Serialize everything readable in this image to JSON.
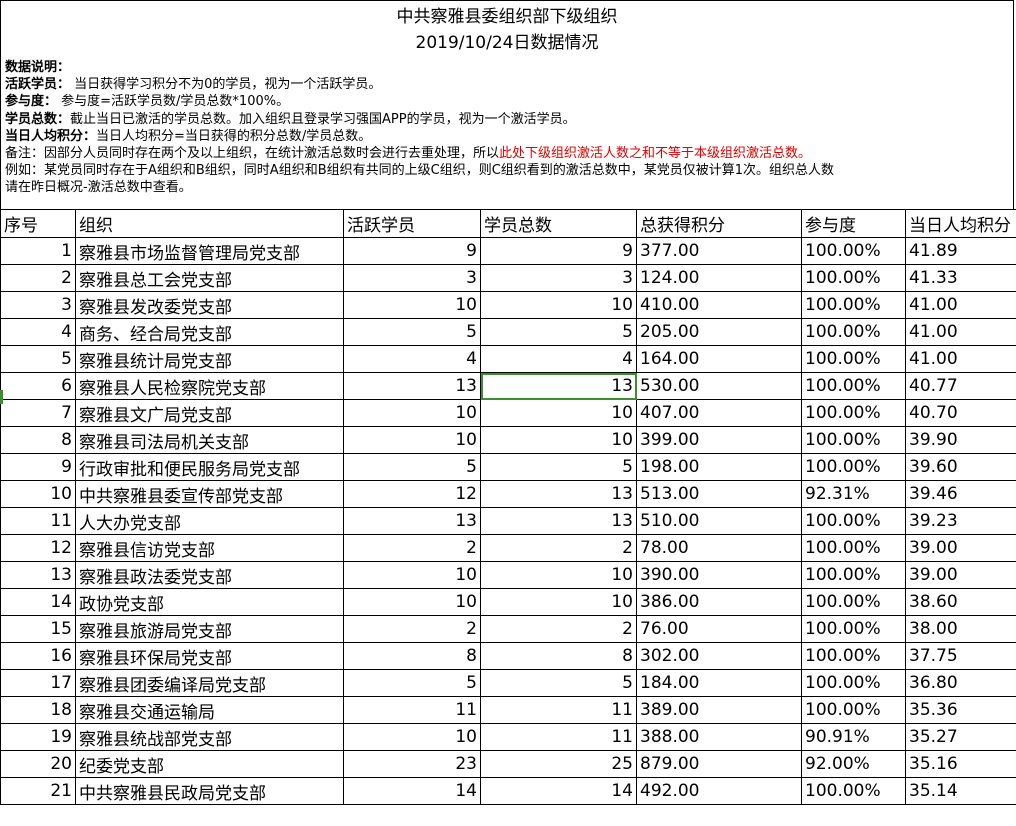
{
  "title": {
    "line1": "中共察雅县委组织部下级组织",
    "line2": "2019/10/24日数据情况"
  },
  "notes": {
    "header": "数据说明：",
    "active_label": "活跃学员：",
    "active_text": "  当日获得学习积分不为0的学员，视为一个活跃学员。",
    "participation_label": "参与度：",
    "participation_text": "  参与度=活跃学员数/学员总数*100%。",
    "total_label": "学员总数：",
    "total_text": "截止当日已激活的学员总数。加入组织且登录学习强国APP的学员，视为一个激活学员。",
    "avg_label": "当日人均积分：",
    "avg_text": "当日人均积分=当日获得的积分总数/学员总数。",
    "remark_prefix": "备注：因部分人员同时存在两个及以上组织，在统计激活总数时会进行去重处理，所以",
    "remark_red": "此处下级组织激活人数之和不等于本级组织激活总数。",
    "example": "例如：某党员同时存在于A组织和B组织，同时A组织和B组织有共同的上级C组织，则C组织看到的激活总数中，某党员仅被计算1次。组织总人数",
    "example2": "请在昨日概况-激活总数中查看。"
  },
  "columns": [
    "序号",
    "组织",
    "活跃学员",
    "学员总数",
    "总获得积分",
    "参与度",
    "当日人均积分"
  ],
  "rows": [
    [
      "1",
      "察雅县市场监督管理局党支部",
      "9",
      "9",
      "377.00",
      "100.00%",
      "41.89"
    ],
    [
      "2",
      "察雅县总工会党支部",
      "3",
      "3",
      "124.00",
      "100.00%",
      "41.33"
    ],
    [
      "3",
      "察雅县发改委党支部",
      "10",
      "10",
      "410.00",
      "100.00%",
      "41.00"
    ],
    [
      "4",
      "商务、经合局党支部",
      "5",
      "5",
      "205.00",
      "100.00%",
      "41.00"
    ],
    [
      "5",
      "察雅县统计局党支部",
      "4",
      "4",
      "164.00",
      "100.00%",
      "41.00"
    ],
    [
      "6",
      "察雅县人民检察院党支部",
      "13",
      "13",
      "530.00",
      "100.00%",
      "40.77"
    ],
    [
      "7",
      "察雅县文广局党支部",
      "10",
      "10",
      "407.00",
      "100.00%",
      "40.70"
    ],
    [
      "8",
      "察雅县司法局机关支部",
      "10",
      "10",
      "399.00",
      "100.00%",
      "39.90"
    ],
    [
      "9",
      "行政审批和便民服务局党支部",
      "5",
      "5",
      "198.00",
      "100.00%",
      "39.60"
    ],
    [
      "10",
      "中共察雅县委宣传部党支部",
      "12",
      "13",
      "513.00",
      "92.31%",
      "39.46"
    ],
    [
      "11",
      "人大办党支部",
      "13",
      "13",
      "510.00",
      "100.00%",
      "39.23"
    ],
    [
      "12",
      "察雅县信访党支部",
      "2",
      "2",
      "78.00",
      "100.00%",
      "39.00"
    ],
    [
      "13",
      "察雅县政法委党支部",
      "10",
      "10",
      "390.00",
      "100.00%",
      "39.00"
    ],
    [
      "14",
      "政协党支部",
      "10",
      "10",
      "386.00",
      "100.00%",
      "38.60"
    ],
    [
      "15",
      "察雅县旅游局党支部",
      "2",
      "2",
      "76.00",
      "100.00%",
      "38.00"
    ],
    [
      "16",
      "察雅县环保局党支部",
      "8",
      "8",
      "302.00",
      "100.00%",
      "37.75"
    ],
    [
      "17",
      "察雅县团委编译局党支部",
      "5",
      "5",
      "184.00",
      "100.00%",
      "36.80"
    ],
    [
      "18",
      "察雅县交通运输局",
      "11",
      "11",
      "389.00",
      "100.00%",
      "35.36"
    ],
    [
      "19",
      "察雅县统战部党支部",
      "10",
      "11",
      "388.00",
      "90.91%",
      "35.27"
    ],
    [
      "20",
      "纪委党支部",
      "23",
      "25",
      "879.00",
      "92.00%",
      "35.16"
    ],
    [
      "21",
      "中共察雅县民政局党支部",
      "14",
      "14",
      "492.00",
      "100.00%",
      "35.14"
    ]
  ],
  "selected_cell": {
    "row": 6,
    "column": "学员总数"
  },
  "colors": {
    "selection": "#3c8f2f",
    "remark_red": "#e00000"
  }
}
